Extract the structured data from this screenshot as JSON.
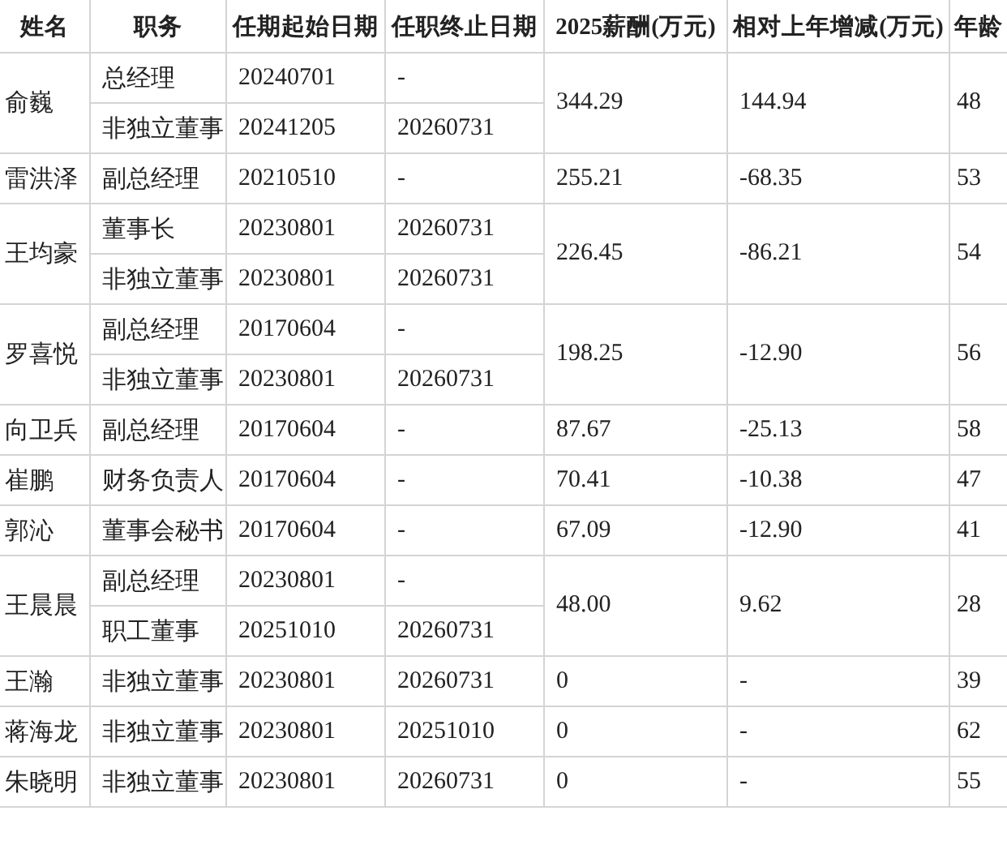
{
  "table": {
    "columns": [
      "姓名",
      "职务",
      "任期起始日期",
      "任职终止日期",
      "2025薪酬(万元)",
      "相对上年增减(万元)",
      "年龄"
    ],
    "rows": [
      {
        "name": "俞巍",
        "roles": [
          {
            "title": "总经理",
            "start": "20240701",
            "end": "-"
          },
          {
            "title": "非独立董事",
            "start": "20241205",
            "end": "20260731"
          }
        ],
        "salary": "344.29",
        "change": "144.94",
        "age": "48"
      },
      {
        "name": "雷洪泽",
        "roles": [
          {
            "title": "副总经理",
            "start": "20210510",
            "end": "-"
          }
        ],
        "salary": "255.21",
        "change": "-68.35",
        "age": "53"
      },
      {
        "name": "王均豪",
        "roles": [
          {
            "title": "董事长",
            "start": "20230801",
            "end": "20260731"
          },
          {
            "title": "非独立董事",
            "start": "20230801",
            "end": "20260731"
          }
        ],
        "salary": "226.45",
        "change": "-86.21",
        "age": "54"
      },
      {
        "name": "罗喜悦",
        "roles": [
          {
            "title": "副总经理",
            "start": "20170604",
            "end": "-"
          },
          {
            "title": "非独立董事",
            "start": "20230801",
            "end": "20260731"
          }
        ],
        "salary": "198.25",
        "change": "-12.90",
        "age": "56"
      },
      {
        "name": "向卫兵",
        "roles": [
          {
            "title": "副总经理",
            "start": "20170604",
            "end": "-"
          }
        ],
        "salary": "87.67",
        "change": "-25.13",
        "age": "58"
      },
      {
        "name": "崔鹏",
        "roles": [
          {
            "title": "财务负责人",
            "start": "20170604",
            "end": "-"
          }
        ],
        "salary": "70.41",
        "change": "-10.38",
        "age": "47"
      },
      {
        "name": "郭沁",
        "roles": [
          {
            "title": "董事会秘书",
            "start": "20170604",
            "end": "-"
          }
        ],
        "salary": "67.09",
        "change": "-12.90",
        "age": "41"
      },
      {
        "name": "王晨晨",
        "roles": [
          {
            "title": "副总经理",
            "start": "20230801",
            "end": "-"
          },
          {
            "title": "职工董事",
            "start": "20251010",
            "end": "20260731"
          }
        ],
        "salary": "48.00",
        "change": "9.62",
        "age": "28"
      },
      {
        "name": "王瀚",
        "roles": [
          {
            "title": "非独立董事",
            "start": "20230801",
            "end": "20260731"
          }
        ],
        "salary": "0",
        "change": "-",
        "age": "39"
      },
      {
        "name": "蒋海龙",
        "roles": [
          {
            "title": "非独立董事",
            "start": "20230801",
            "end": "20251010"
          }
        ],
        "salary": "0",
        "change": "-",
        "age": "62"
      },
      {
        "name": "朱晓明",
        "roles": [
          {
            "title": "非独立董事",
            "start": "20230801",
            "end": "20260731"
          }
        ],
        "salary": "0",
        "change": "-",
        "age": "55"
      }
    ]
  }
}
